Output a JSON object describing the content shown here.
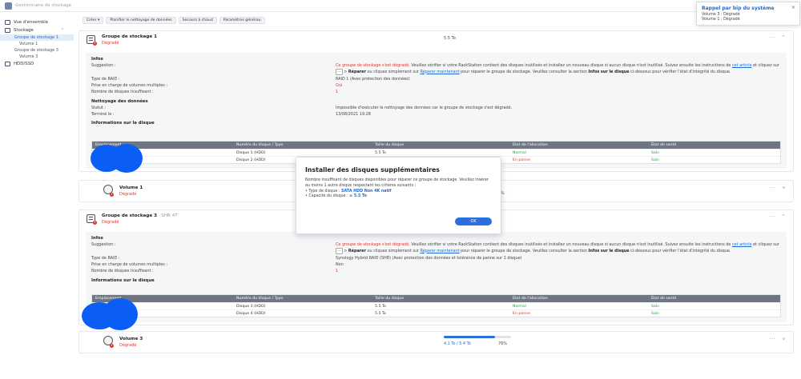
{
  "app": {
    "title": "Gestionnaire de stockage"
  },
  "notification": {
    "title": "Rappel par bip du système",
    "lines": [
      "Volume 3 : Dégradé",
      "Volume 1 : Dégradé"
    ],
    "close": "×"
  },
  "sidebar": {
    "items": [
      {
        "label": "Vue d'ensemble"
      },
      {
        "label": "Stockage"
      },
      {
        "label": "Groupe de stockage 1"
      },
      {
        "label": "Volume 1"
      },
      {
        "label": "Groupe de stockage 3"
      },
      {
        "label": "Volume 3"
      },
      {
        "label": "HDD/SSD"
      }
    ]
  },
  "toolbar": {
    "create": "Créer ▾",
    "schedule": "Planifier le nettoyage de données",
    "hot_spare": "Secours à chaud",
    "general": "Paramètres générau"
  },
  "pool1": {
    "title": "Groupe de stockage 1",
    "status": "Dégradé",
    "size": "5.5 To",
    "more": "···",
    "collapse": "^",
    "infos_title": "Infos",
    "suggestion_label": "Suggestion :",
    "suggestion_red": "Ce groupe de stockage s'est dégradé.",
    "suggestion_text1": " Veuillez vérifier si votre RackStation contient des disques inutilisés et installez un nouveau disque si aucun disque n'est inutilisé. Suivez ensuite les instructions de ",
    "suggestion_link1": "cet article",
    "suggestion_text2": " et cliquez sur ",
    "suggestion_kbd": "···",
    "suggestion_text3": " > ",
    "suggestion_bold1": "Réparer",
    "suggestion_text4": " ou cliquez simplement sur ",
    "suggestion_link2": "Réparer maintenant",
    "suggestion_text5": " pour réparer le groupe de stockage. Veuillez consulter la section ",
    "suggestion_bold2": "Infos sur le disque",
    "suggestion_text6": " ci-dessous pour vérifier l'état d'intégrité du disque.",
    "raid_label": "Type de RAID :",
    "raid_value": "RAID 1 (Avec protection des données)",
    "multi_label": "Prise en charge de volumes multiples :",
    "multi_value": "Oui",
    "insuff_label": "Nombre de disques insuffisant :",
    "insuff_value": "1",
    "scrub_title": "Nettoyage des données",
    "scrub_status_label": "Statut :",
    "scrub_status_value": "Impossible d'exécuter le nettoyage des données car le groupe de stockage s'est dégradé.",
    "scrub_done_label": "Terminé le :",
    "scrub_done_value": "13/08/2021 19:28",
    "disk_info_title": "Informations sur le disque",
    "table_headers": [
      "Emplacement",
      "Numéro du disque / Type",
      "Taille du disque",
      "État de l'allocation",
      "État de santé"
    ],
    "rows": [
      {
        "slot": "",
        "disk": "Disque 1 (HDD)",
        "size": "5.5 To",
        "alloc": "Normal",
        "health": "Sain"
      },
      {
        "slot": "",
        "disk": "Disque 2 (HDD)",
        "size": "5.5 To",
        "alloc": "En panne",
        "health": "Sain"
      }
    ]
  },
  "volume1": {
    "title": "Volume 1",
    "status": "Dégradé",
    "usage_pct": "% ",
    "more": "···",
    "expand": "v"
  },
  "pool3": {
    "title": "Groupe de stockage 3",
    "subtitle": " · SHR 4T",
    "status": "Dégradé",
    "more": "···",
    "collapse": "^",
    "infos_title": "Infos",
    "suggestion_label": "Suggestion :",
    "suggestion_red": "Ce groupe de stockage s'est dégradé.",
    "suggestion_text1": " Veuillez vérifier si votre RackStation contient des disques inutilisés et installez un nouveau disque si aucun disque n'est inutilisé. Suivez ensuite les instructions de ",
    "suggestion_link1": "cet article",
    "suggestion_text2": " et cliquez sur ",
    "suggestion_kbd": "···",
    "suggestion_text3": " > ",
    "suggestion_bold1": "Réparer",
    "suggestion_text4": " ou cliquez simplement sur ",
    "suggestion_link2": "Réparer maintenant",
    "suggestion_text5": " pour réparer le groupe de stockage. Veuillez consulter la section ",
    "suggestion_bold2": "Infos sur le disque",
    "suggestion_text6": " ci-dessous pour vérifier l'état d'intégrité du disque.",
    "raid_label": "Type de RAID :",
    "raid_value": "Synology Hybrid RAID (SHR) (Avec protection des données et tolérance de panne sur 1 disque)",
    "multi_label": "Prise en charge de volumes multiples :",
    "multi_value": "Non",
    "insuff_label": "Nombre de disques insuffisant :",
    "insuff_value": "1",
    "disk_info_title": "Informations sur le disque",
    "table_headers": [
      "Emplacement",
      "Numéro du disque / Type",
      "Taille du disque",
      "État de l'allocation",
      "État de santé"
    ],
    "rows": [
      {
        "slot": "",
        "disk": "Disque 3 (HDD)",
        "size": "5.5 To",
        "alloc": "Normal",
        "health": "Sain"
      },
      {
        "slot": "",
        "disk": "Disque 4 (HDD)",
        "size": "5.5 To",
        "alloc": "En panne",
        "health": "Sain"
      }
    ]
  },
  "volume3": {
    "title": "Volume 3",
    "status": "Dégradé",
    "usage": "4.1 To / 5.4 To",
    "pct": "76%",
    "progress": 0.76,
    "more": "···",
    "expand": "v"
  },
  "dialog": {
    "title": "Installer des disques supplémentaires",
    "intro": "Nombre insuffisant de disques disponibles pour réparer ce groupe de stockage. Veuillez insérer au moins 1 autre disque respectant les critères suivants :",
    "type_label": "• Type de disque : ",
    "type_value": "SATA HDD Non 4K natif",
    "cap_label": "• Capacité du disque : ",
    "cap_value": "≥ 5.5 To",
    "ok": "OK"
  },
  "colors": {
    "accent": "#2a6fdb",
    "danger": "#e0352b",
    "ok": "#2e9d3e",
    "redaction": "#0a5ef5"
  }
}
